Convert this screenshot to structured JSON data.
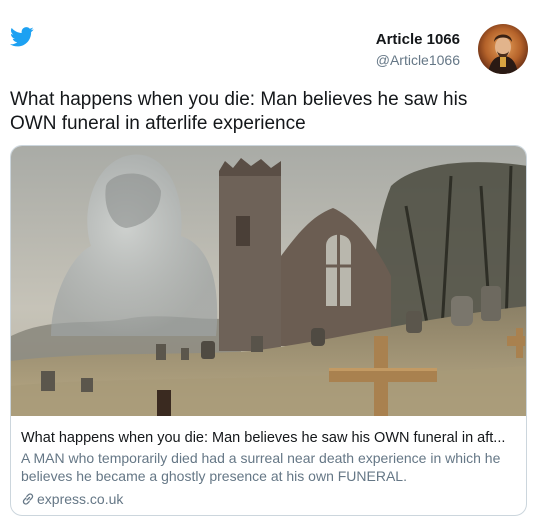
{
  "tweet": {
    "author_name": "Article 1066",
    "author_handle": "@Article1066",
    "text": "What happens when you die: Man believes he saw his OWN funeral in afterlife experience"
  },
  "link_card": {
    "title": "What happens when you die: Man believes he saw his OWN funeral in aft...",
    "description": "A MAN who temporarily died had a surreal near death experience in which he believes he became a ghostly presence at his own FUNERAL.",
    "domain": "express.co.uk"
  },
  "icons": {
    "brand": "twitter-bird-icon",
    "link": "link-icon"
  },
  "colors": {
    "twitter_blue": "#1da1f2",
    "text": "#14171a",
    "secondary_text": "#657786",
    "border": "#ccd6dd"
  }
}
